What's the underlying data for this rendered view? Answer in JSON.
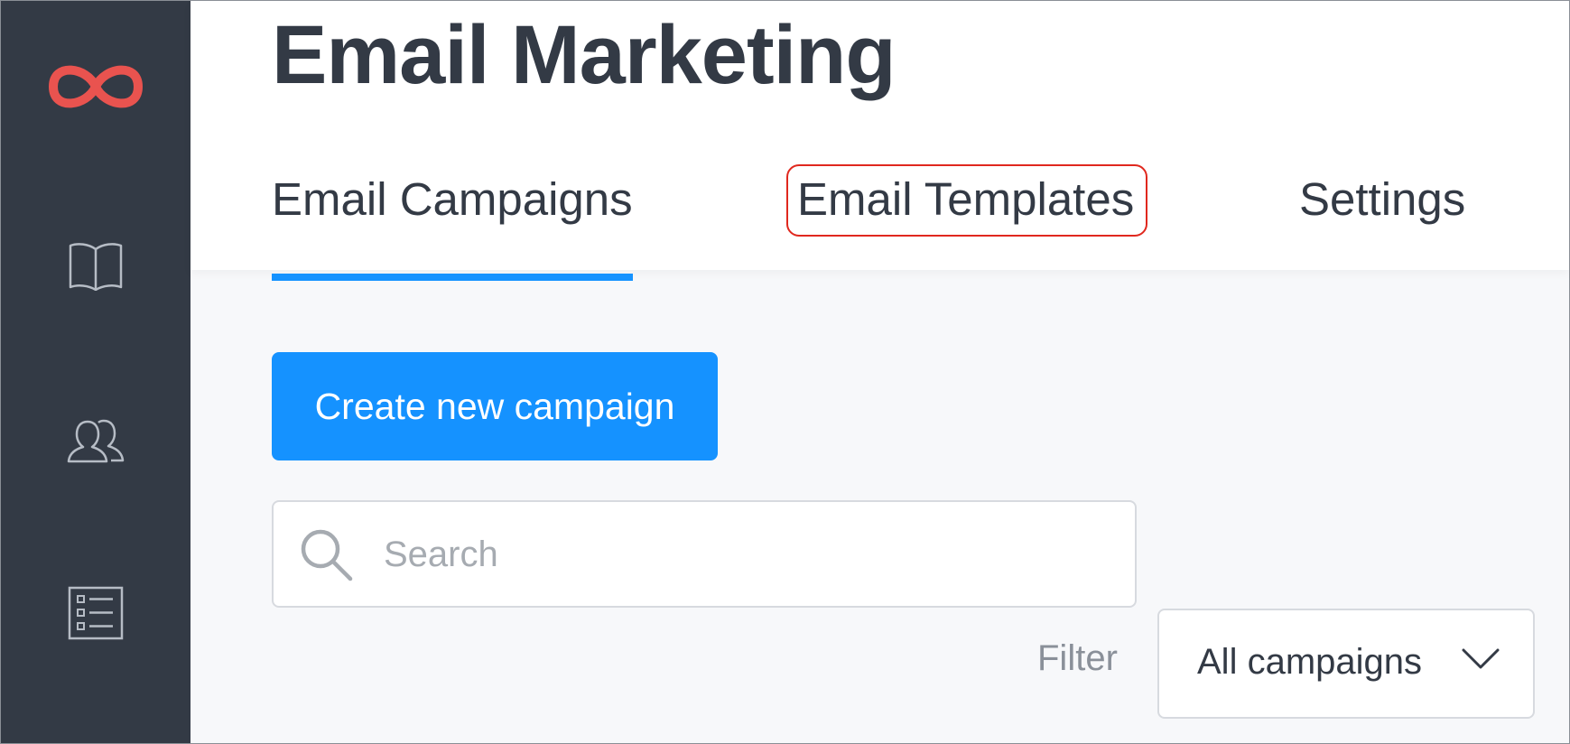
{
  "app": {
    "brand_color": "#e9534f",
    "accent_color": "#1592ff",
    "sidebar_color": "#333a45"
  },
  "sidebar": {
    "logo_icon": "infinity-logo-icon",
    "items": [
      {
        "icon": "book-icon"
      },
      {
        "icon": "contacts-icon"
      },
      {
        "icon": "checklist-icon"
      }
    ]
  },
  "header": {
    "title": "Email Marketing",
    "tabs": [
      {
        "label": "Email Campaigns",
        "active": true
      },
      {
        "label": "Email Templates",
        "active": false,
        "highlighted": true
      },
      {
        "label": "Settings",
        "active": false
      }
    ]
  },
  "main": {
    "create_button_label": "Create new campaign",
    "search": {
      "placeholder": "Search",
      "value": "",
      "icon": "search-icon"
    },
    "filter": {
      "label": "Filter",
      "selected": "All campaigns",
      "icon": "chevron-down-icon"
    }
  }
}
